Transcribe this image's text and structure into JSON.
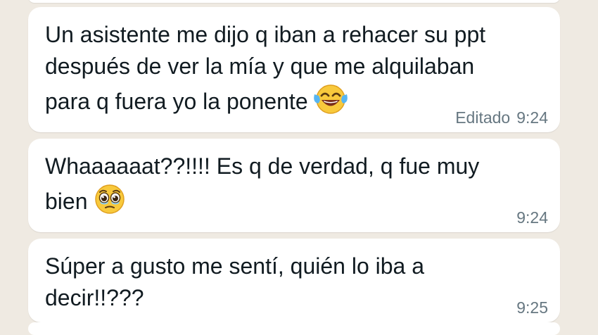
{
  "messages": [
    {
      "text": "Un asistente me dijo q iban a rehacer su ppt\ndespués de ver la mía y que me alquilaban\npara q fuera yo la ponente",
      "emoji": "face-with-tears-of-joy",
      "edited_label": "Editado",
      "time": "9:24"
    },
    {
      "text": "Whaaaaaat??!!!! Es q de verdad, q fue muy\nbien",
      "emoji": "face-holding-back-tears",
      "edited_label": "",
      "time": "9:24"
    },
    {
      "text": "Súper a gusto me sentí, quién lo iba a\ndecir!!???",
      "emoji": "",
      "edited_label": "",
      "time": "9:25"
    }
  ],
  "colors": {
    "chat_background": "#efeae2",
    "bubble": "#ffffff",
    "text": "#111b21",
    "meta": "#667781"
  }
}
